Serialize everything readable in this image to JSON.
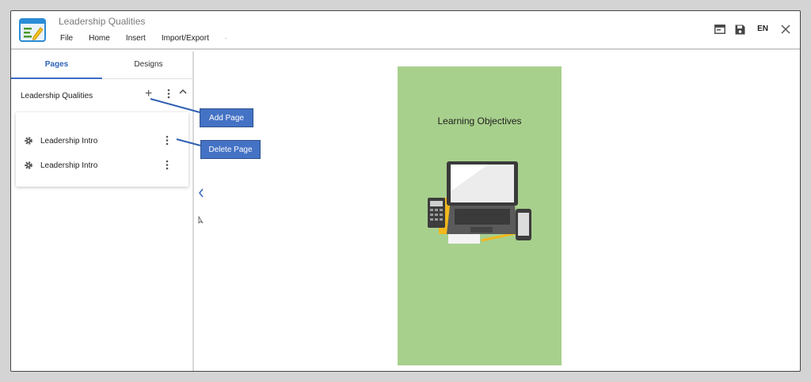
{
  "app": {
    "document_title": "Leadership Qualities",
    "logo_icon": "editor-document-icon"
  },
  "menu": {
    "items": [
      "File",
      "Home",
      "Insert",
      "Import/Export"
    ],
    "trailing": "."
  },
  "toolbar_right": {
    "preview_icon": "window-icon",
    "save_icon": "floppy-disk-icon",
    "language": "EN",
    "close_icon": "close-icon"
  },
  "left_panel": {
    "tabs": [
      {
        "label": "Pages",
        "active": true
      },
      {
        "label": "Designs",
        "active": false
      }
    ],
    "section": {
      "title": "Leadership Qualities",
      "add_icon": "plus-icon",
      "more_icon": "kebab-icon",
      "collapse_icon": "chevron-up-icon"
    },
    "pages": [
      {
        "label": "Leadership Intro",
        "icon": "gear-icon"
      },
      {
        "label": "Leadership Intro",
        "icon": "gear-icon"
      }
    ]
  },
  "callouts": {
    "add_page": "Add Page",
    "delete_page": "Delete Page"
  },
  "slide": {
    "title": "Learning Objectives",
    "background": "#a8d08d",
    "illustration": "laptop-calculator-phone-illustration"
  },
  "colors": {
    "accent": "#2f63b8",
    "callout": "#4472c4",
    "slide_bg": "#a8d08d"
  }
}
